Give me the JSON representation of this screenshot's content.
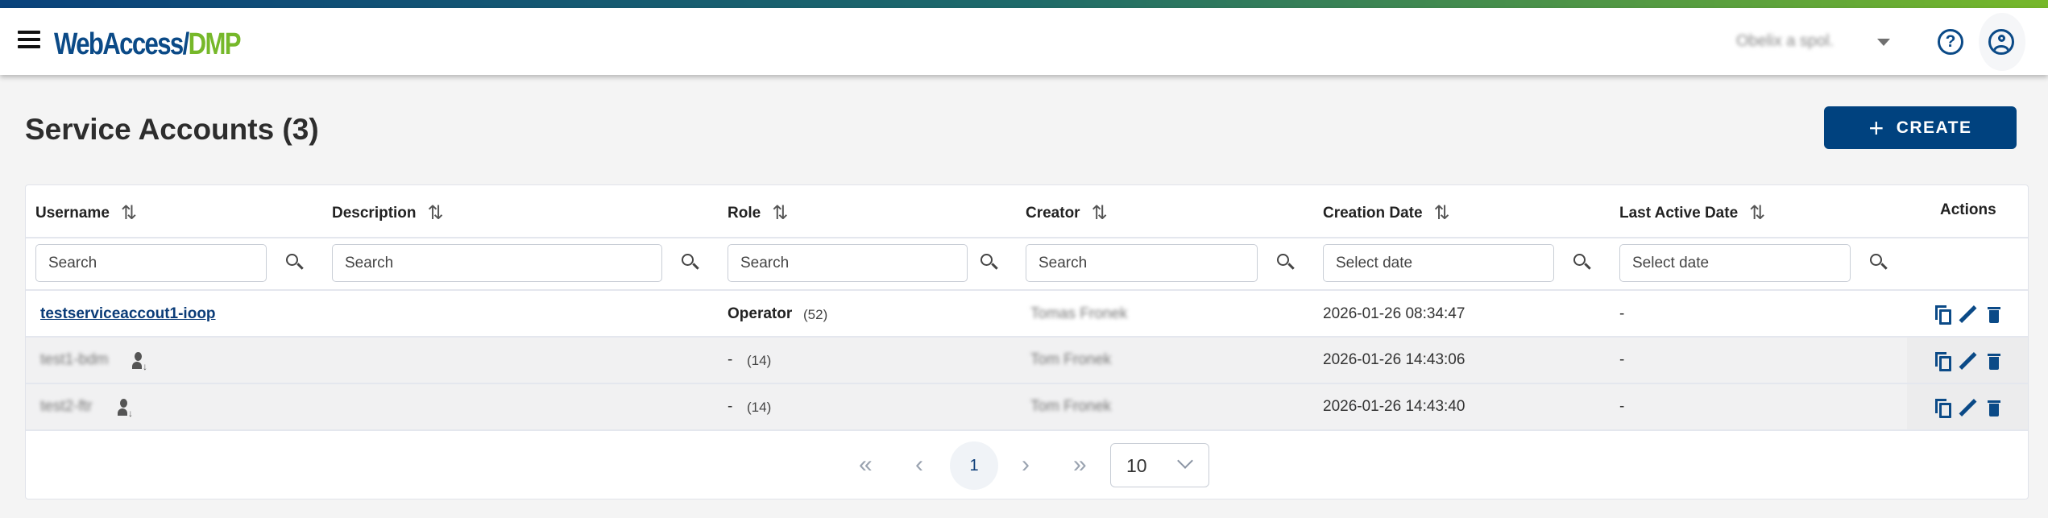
{
  "header": {
    "logo_part1": "WebAccess/",
    "logo_part2": "DMP",
    "organization": "Obelix a spol.",
    "help_icon": "?"
  },
  "page": {
    "title": "Service Accounts (3)",
    "create_label": "CREATE",
    "create_icon": "+"
  },
  "table": {
    "columns": [
      {
        "label": "Username",
        "sort": "⇅"
      },
      {
        "label": "Description",
        "sort": "⇅"
      },
      {
        "label": "Role",
        "sort": "⇅"
      },
      {
        "label": "Creator",
        "sort": "⇅"
      },
      {
        "label": "Creation Date",
        "sort": "⇅"
      },
      {
        "label": "Last Active Date",
        "sort": "⇅"
      },
      {
        "label": "Actions"
      }
    ],
    "filters": {
      "username": "Search",
      "description": "Search",
      "role": "Search",
      "creator": "Search",
      "creation_date": "Select date",
      "last_active_date": "Select date"
    },
    "rows": [
      {
        "username": "testserviceaccout1-ioop",
        "role": "Operator",
        "role_count": "(52)",
        "creator": "Tomas Fronek",
        "creation_date": "2026-01-26 08:34:47",
        "last_active": "-"
      },
      {
        "username": "test1-bdm",
        "role": "-",
        "role_count": "(14)",
        "creator": "Tom Fronek",
        "creation_date": "2026-01-26 14:43:06",
        "last_active": "-"
      },
      {
        "username": "test2-ftr",
        "role": "-",
        "role_count": "(14)",
        "creator": "Tom Fronek",
        "creation_date": "2026-01-26 14:43:40",
        "last_active": "-"
      }
    ]
  },
  "pagination": {
    "first": "«",
    "prev": "‹",
    "current": "1",
    "next": "›",
    "last": "»",
    "page_size": "10"
  },
  "colors": {
    "brand_blue": "#00427f",
    "brand_green": "#76b82a"
  }
}
